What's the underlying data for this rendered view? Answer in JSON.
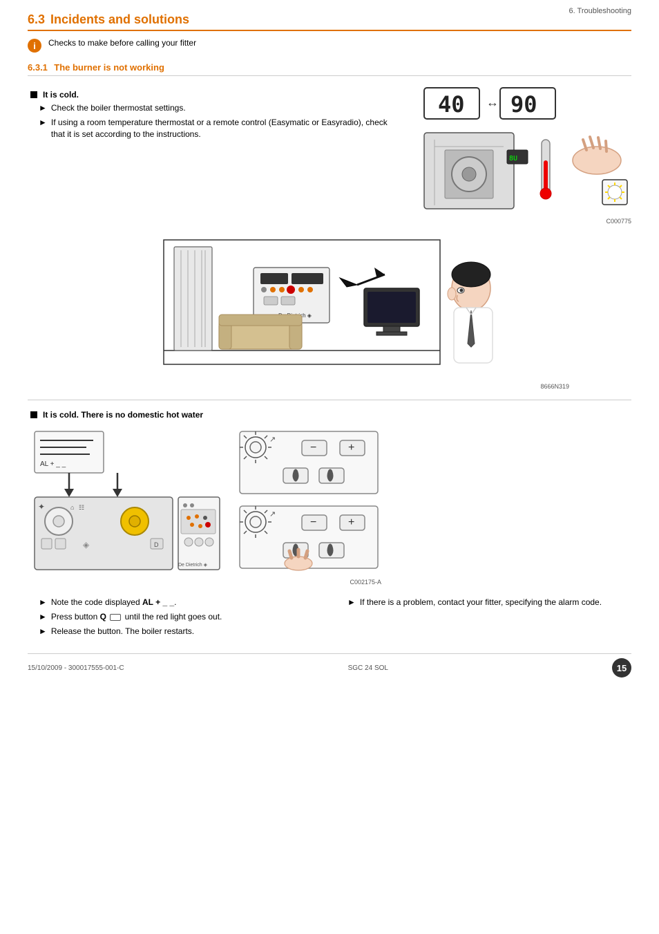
{
  "page": {
    "top_right_label": "6. Troubleshooting",
    "section_number": "6.3",
    "section_title": "Incidents and solutions",
    "info_text": "Checks to make before calling your fitter",
    "sub_section_number": "6.3.1",
    "sub_section_title": "The burner is not working",
    "bullet_cold_label": "It is cold.",
    "bullet_cold_item1": "Check the boiler thermostat settings.",
    "bullet_cold_item2": "If using a room temperature thermostat or a remote control (Easymatic or Easyradio), check that it is set according to the instructions.",
    "image_caption1": "C000775",
    "image_caption2": "8666N319",
    "bullet_cold_dhw_label": "It is cold. There is no domestic hot water",
    "image_caption3": "C002175-A",
    "bottom_bullet1": "Note the code displayed AL + _ _.",
    "bottom_bullet2": "Press button Q",
    "bottom_bullet2_bold": " until the red light goes out.",
    "bottom_bullet3": "Release the button. The boiler restarts.",
    "bottom_bullet_right1": "If there is a problem, contact your fitter, specifying the alarm code.",
    "footer_date": "15/10/2009 - 300017555-001-C",
    "footer_model": "SGC 24 SOL",
    "footer_page": "15"
  }
}
